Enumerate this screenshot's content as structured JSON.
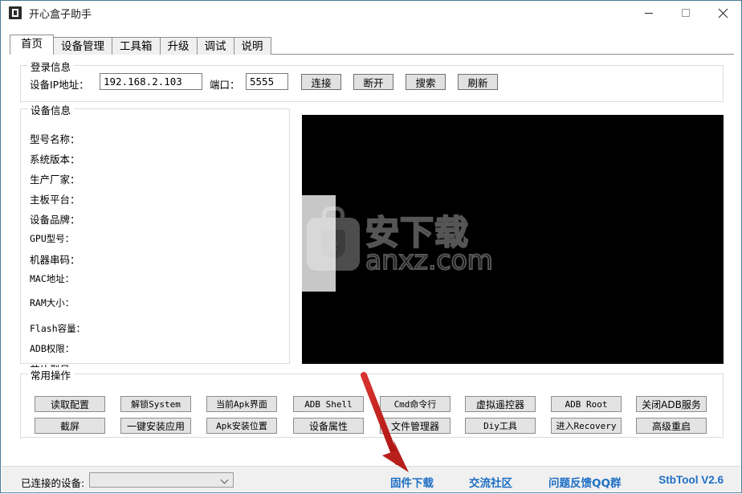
{
  "window": {
    "title": "开心盒子助手",
    "icon": "app-icon",
    "controls": {
      "minimize": "minimize-icon",
      "maximize": "maximize-icon",
      "close": "close-icon"
    }
  },
  "tabs": [
    {
      "label": "首页",
      "active": true
    },
    {
      "label": "设备管理",
      "active": false
    },
    {
      "label": "工具箱",
      "active": false
    },
    {
      "label": "升级",
      "active": false
    },
    {
      "label": "调试",
      "active": false
    },
    {
      "label": "说明",
      "active": false
    }
  ],
  "login_group": {
    "title": "登录信息",
    "ip_label": "设备IP地址：",
    "ip_value": "192.168.2.103",
    "port_label": "端口：",
    "port_value": "5555",
    "buttons": [
      {
        "label": "连接",
        "name": "connect-button"
      },
      {
        "label": "断开",
        "name": "disconnect-button"
      },
      {
        "label": "搜索",
        "name": "search-button"
      },
      {
        "label": "刷新",
        "name": "refresh-button"
      }
    ]
  },
  "device_group": {
    "title": "设备信息",
    "fields": [
      {
        "label": "型号名称：",
        "value": ""
      },
      {
        "label": "系统版本：",
        "value": ""
      },
      {
        "label": "生产厂家：",
        "value": ""
      },
      {
        "label": "主板平台：",
        "value": ""
      },
      {
        "label": "设备品牌：",
        "value": ""
      },
      {
        "label": "GPU型号：",
        "value": ""
      },
      {
        "label": "机器串码：",
        "value": ""
      },
      {
        "label": "MAC地址：",
        "value": ""
      },
      {
        "label": "RAM大小：",
        "value": ""
      },
      {
        "label": "Flash容量：",
        "value": ""
      },
      {
        "label": "ADB权限：",
        "value": ""
      },
      {
        "label": "芯片型号：",
        "value": ""
      }
    ]
  },
  "preview": {
    "name": "screen-preview",
    "background": "#000000",
    "watermark_cn": "安下载",
    "watermark_en": "anxz.com",
    "watermark_badge": "安"
  },
  "ops_group": {
    "title": "常用操作",
    "row1": [
      {
        "label": "读取配置",
        "name": "read-config-button",
        "mono": false
      },
      {
        "label": "解锁System",
        "name": "unlock-system-button",
        "mono": true
      },
      {
        "label": "当前Apk界面",
        "name": "current-apk-ui-button",
        "mono": true
      },
      {
        "label": "ADB Shell",
        "name": "adb-shell-button",
        "mono": true
      },
      {
        "label": "Cmd命令行",
        "name": "cmd-console-button",
        "mono": true
      },
      {
        "label": "虚拟遥控器",
        "name": "virtual-remote-button",
        "mono": false
      },
      {
        "label": "ADB  Root",
        "name": "adb-root-button",
        "mono": true
      },
      {
        "label": "关闭ADB服务",
        "name": "stop-adb-service-button",
        "mono": false
      }
    ],
    "row2": [
      {
        "label": "截屏",
        "name": "screenshot-button",
        "mono": false
      },
      {
        "label": "一键安装应用",
        "name": "one-click-install-button",
        "mono": false
      },
      {
        "label": "Apk安装位置",
        "name": "apk-install-path-button",
        "mono": true
      },
      {
        "label": "设备属性",
        "name": "device-properties-button",
        "mono": false
      },
      {
        "label": "文件管理器",
        "name": "file-manager-button",
        "mono": false
      },
      {
        "label": "Diy工具",
        "name": "diy-tool-button",
        "mono": true
      },
      {
        "label": "进入Recovery",
        "name": "enter-recovery-button",
        "mono": true
      },
      {
        "label": "高级重启",
        "name": "advanced-reboot-button",
        "mono": false
      }
    ]
  },
  "statusbar": {
    "connected_label": "已连接的设备:",
    "connected_value": "",
    "links": [
      {
        "label": "固件下载",
        "name": "firmware-download-link"
      },
      {
        "label": "交流社区",
        "name": "community-link"
      },
      {
        "label": "问题反馈QQ群",
        "name": "feedback-qq-link"
      }
    ],
    "version": "StbTool V2.6"
  },
  "annotation": {
    "arrow_color": "#c0201c",
    "points_to": "固件下载"
  }
}
